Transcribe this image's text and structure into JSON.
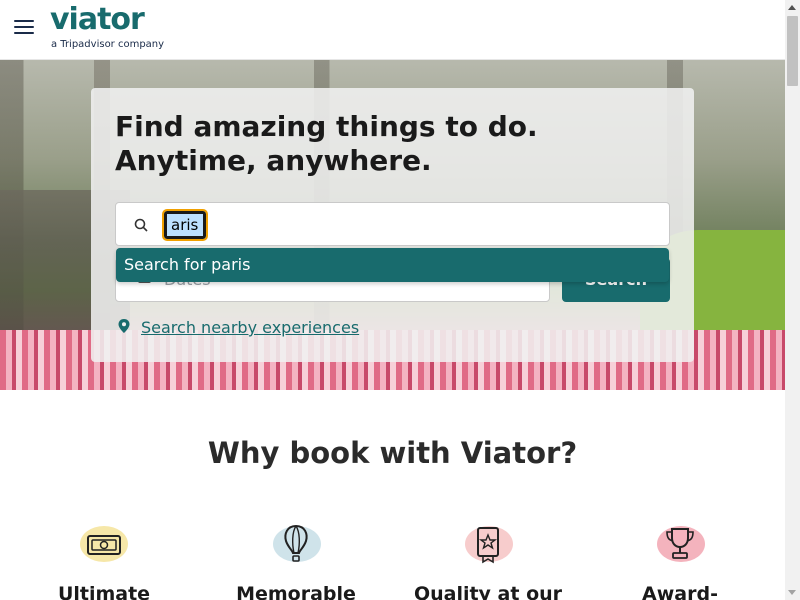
{
  "header": {
    "logo_text": "viator",
    "logo_sub": "a Tripadvisor company",
    "menu_icon": "hamburger-menu-icon"
  },
  "hero": {
    "headline": "Find amazing things to do. Anytime, anywhere.",
    "search": {
      "value": "aris",
      "icon": "search-icon"
    },
    "dropdown": {
      "suggestion": "Search for paris"
    },
    "dates": {
      "placeholder": "Dates",
      "icon": "calendar-icon"
    },
    "search_button": "Search",
    "nearby": {
      "label": "Search nearby experiences",
      "icon": "location-pin-icon"
    }
  },
  "why": {
    "title": "Why book with Viator?",
    "features": [
      {
        "label": "Ultimate",
        "icon": "money-icon",
        "blob_color": "#f6e7a8"
      },
      {
        "label": "Memorable",
        "icon": "hot-air-balloon-icon",
        "blob_color": "#cfe3ea"
      },
      {
        "label": "Quality at our",
        "icon": "certificate-star-icon",
        "blob_color": "#f7cccc"
      },
      {
        "label": "Award-",
        "icon": "trophy-icon",
        "blob_color": "#f4b3bd"
      }
    ]
  },
  "colors": {
    "brand": "#186b6d",
    "text": "#1a2b49"
  }
}
